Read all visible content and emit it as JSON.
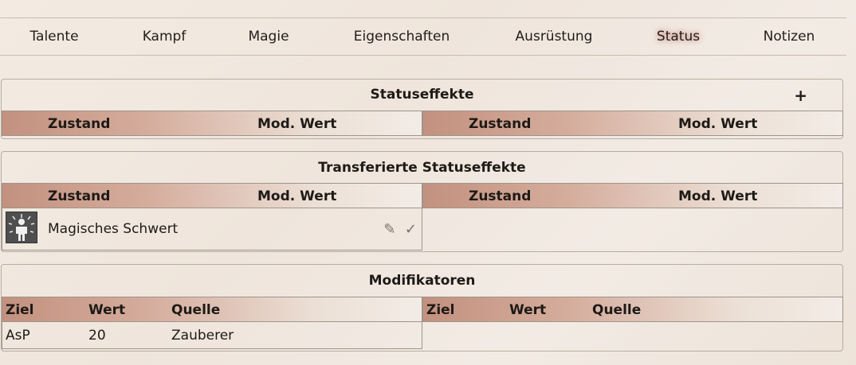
{
  "tabs": [
    "Talente",
    "Kampf",
    "Magie",
    "Eigenschaften",
    "Ausrüstung",
    "Status",
    "Notizen"
  ],
  "active_tab": "Status",
  "statuseffekte": {
    "title": "Statuseffekte",
    "add_label": "+",
    "col_zustand": "Zustand",
    "col_mod": "Mod. Wert"
  },
  "transferiert": {
    "title": "Transferierte Statuseffekte",
    "col_zustand": "Zustand",
    "col_mod": "Mod. Wert",
    "rows": [
      {
        "name": "Magisches Schwert",
        "icon": "magic-figure-icon"
      }
    ]
  },
  "modifikatoren": {
    "title": "Modifikatoren",
    "col_ziel": "Ziel",
    "col_wert": "Wert",
    "col_quelle": "Quelle",
    "rows": [
      {
        "ziel": "AsP",
        "wert": "20",
        "quelle": "Zauberer"
      }
    ]
  }
}
